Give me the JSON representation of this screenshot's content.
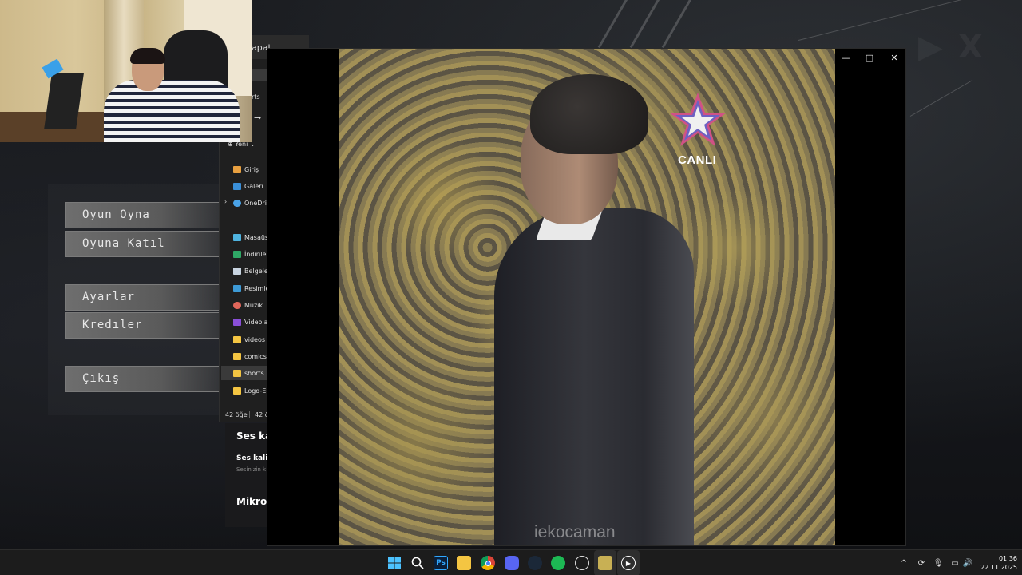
{
  "game_menu": {
    "buttons": [
      "Oyun Oyna",
      "Oyuna Katıl",
      "Ayarlar",
      "Kredıler",
      "Çıkış"
    ]
  },
  "explorer": {
    "tab_title": "apat",
    "nav_label": "rts",
    "new_label": "Yeni",
    "sidebar": [
      {
        "label": "Giriş",
        "icon": "home-icon"
      },
      {
        "label": "Galeri",
        "icon": "gallery-icon"
      },
      {
        "label": "OneDrive",
        "icon": "cloud-icon"
      },
      {
        "label": "Masaüstü",
        "icon": "desktop-icon"
      },
      {
        "label": "İndirilenler",
        "icon": "download-icon"
      },
      {
        "label": "Belgeler",
        "icon": "document-icon"
      },
      {
        "label": "Resimler",
        "icon": "pictures-icon"
      },
      {
        "label": "Müzik",
        "icon": "music-icon"
      },
      {
        "label": "Videolar",
        "icon": "videos-icon"
      },
      {
        "label": "videos",
        "icon": "folder-icon"
      },
      {
        "label": "comics",
        "icon": "folder-icon"
      },
      {
        "label": "shorts",
        "icon": "folder-icon"
      },
      {
        "label": "Logo-E",
        "icon": "folder-icon"
      }
    ],
    "status_count": "42 öğe",
    "status_count2": "42 ö"
  },
  "settings_behind": {
    "heading1": "Ses ka",
    "subheading": "Ses kalit",
    "subtext": "Sesinizin k",
    "heading2": "Mikrof"
  },
  "player": {
    "channel_badge": "CANLI",
    "watermark": "iekocaman",
    "minimize": "—",
    "maximize": "□",
    "close": "✕"
  },
  "taskbar": {
    "apps": [
      "start",
      "search",
      "photoshop",
      "file-explorer",
      "chrome",
      "discord",
      "steam",
      "spotify",
      "chatgpt",
      "game",
      "media-player"
    ],
    "photoshop_label": "Ps",
    "clock_time": "01:36",
    "clock_date": "22.11.2025",
    "tray_chevron": "^"
  },
  "colors": {
    "menu_button": "#5a5a5a",
    "taskbar": "#1c1c1c",
    "spotify": "#1db954",
    "chrome_red": "#db4437",
    "folder": "#f4c542"
  }
}
